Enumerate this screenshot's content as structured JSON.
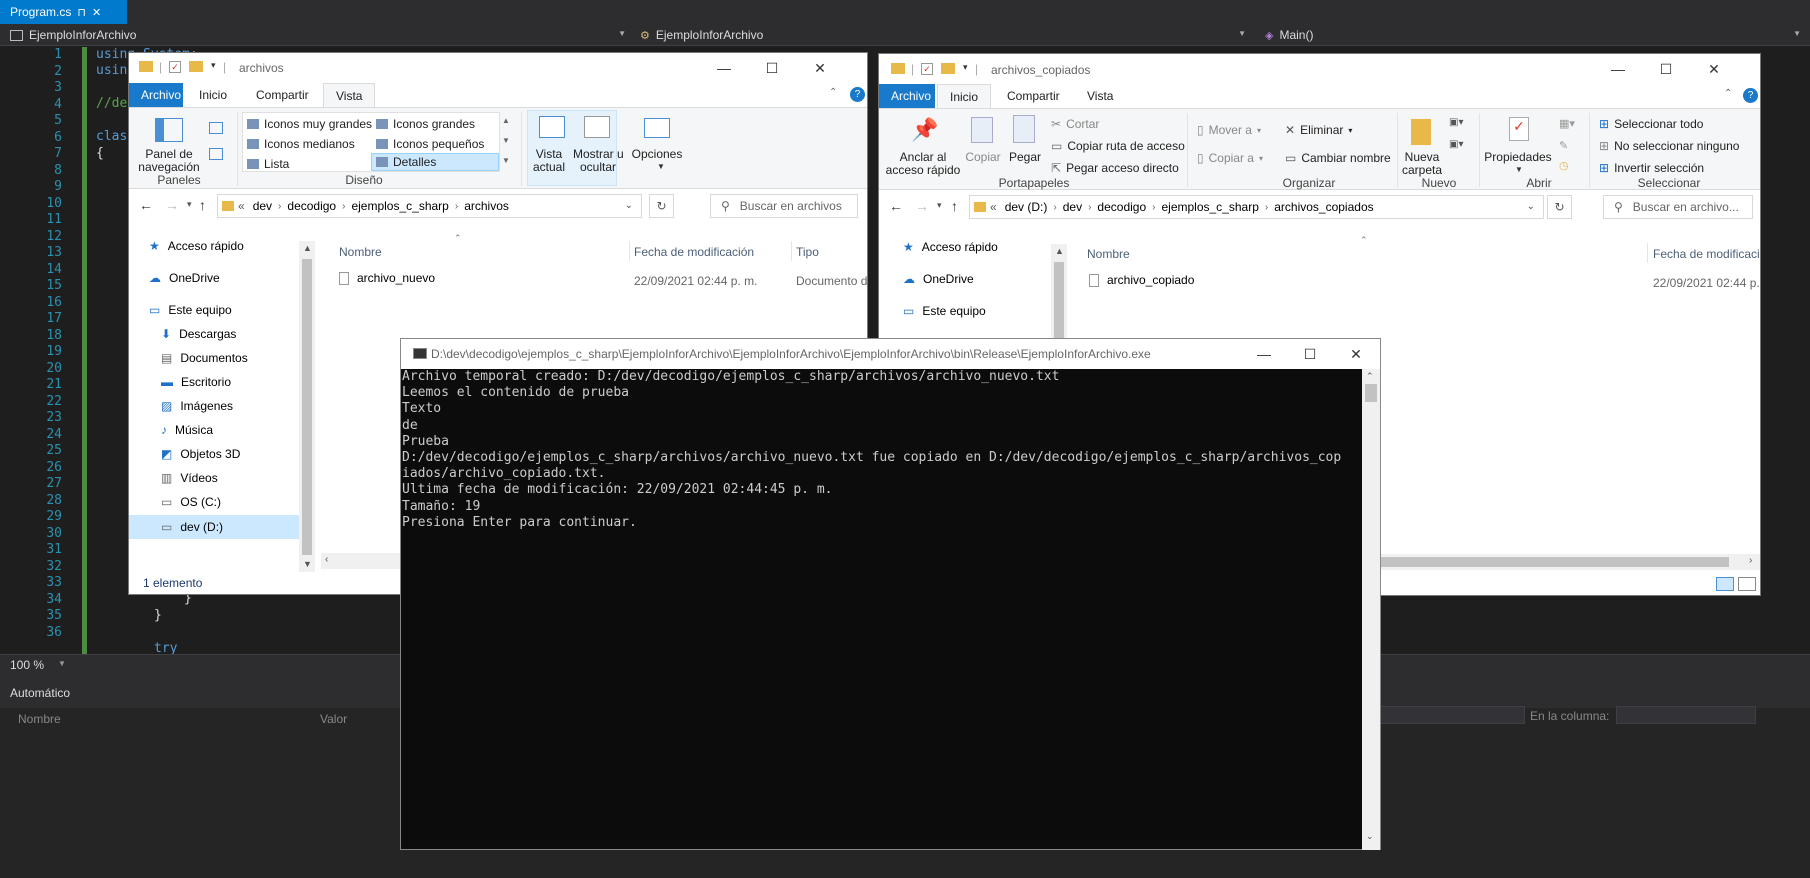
{
  "vs": {
    "tab_title": "Program.cs",
    "tab_pin": "⊓",
    "tab_close": "✕",
    "nav_project": "EjemploInforArchivo",
    "nav_class": "EjemploInforArchivo",
    "nav_member": "Main()",
    "line_numbers": [
      "1",
      "2",
      "3",
      "4",
      "5",
      "6",
      "7",
      "8",
      "9",
      "10",
      "11",
      "12",
      "13",
      "14",
      "15",
      "16",
      "17",
      "18",
      "19",
      "20",
      "21",
      "22",
      "23",
      "24",
      "25",
      "26",
      "27",
      "28",
      "29",
      "30",
      "31",
      "32",
      "33",
      "34",
      "35",
      "36"
    ],
    "code_visible": {
      "l1": "using System;",
      "l2": "using",
      "l4": "//de",
      "l6": "clas",
      "l7": "{",
      "l33": "}",
      "l34": "}",
      "l36": "try"
    },
    "zoom": "100 %",
    "auto_title": "Automático",
    "col_name": "Nombre",
    "col_value": "Valor",
    "col_label": "En la columna:"
  },
  "explorer_left": {
    "title": "archivos",
    "tabs": [
      "Archivo",
      "Inicio",
      "Compartir",
      "Vista"
    ],
    "ribbon": {
      "panel_nav": "Panel de\nnavegación",
      "paneles_label": "Paneles",
      "layouts": [
        "Iconos muy grandes",
        "Iconos grandes",
        "Iconos medianos",
        "Iconos pequeños",
        "Lista",
        "Detalles"
      ],
      "diseno_label": "Diseño",
      "vista_actual": "Vista\nactual",
      "mostrar": "Mostrar u\nocultar",
      "opciones": "Opciones"
    },
    "breadcrumb": [
      "dev",
      "decodigo",
      "ejemplos_c_sharp",
      "archivos"
    ],
    "search_placeholder": "Buscar en archivos",
    "nav": [
      "Acceso rápido",
      "OneDrive",
      "Este equipo",
      "Descargas",
      "Documentos",
      "Escritorio",
      "Imágenes",
      "Música",
      "Objetos 3D",
      "Vídeos",
      "OS (C:)",
      "dev (D:)"
    ],
    "columns": [
      "Nombre",
      "Fecha de modificación",
      "Tipo"
    ],
    "file": {
      "name": "archivo_nuevo",
      "date": "22/09/2021 02:44 p. m.",
      "type": "Documento d"
    },
    "status": "1 elemento"
  },
  "explorer_right": {
    "title": "archivos_copiados",
    "tabs": [
      "Archivo",
      "Inicio",
      "Compartir",
      "Vista"
    ],
    "ribbon": {
      "anclar": "Anclar al\nacceso rápido",
      "copiar": "Copiar",
      "pegar": "Pegar",
      "cortar": "Cortar",
      "copiar_ruta": "Copiar ruta de acceso",
      "pegar_acceso": "Pegar acceso directo",
      "portapapeles": "Portapapeles",
      "mover": "Mover a",
      "copiar_a": "Copiar a",
      "eliminar": "Eliminar",
      "cambiar": "Cambiar nombre",
      "organizar": "Organizar",
      "nueva_carpeta": "Nueva\ncarpeta",
      "nuevo": "Nuevo",
      "propiedades": "Propiedades",
      "abrir": "Abrir",
      "sel_todo": "Seleccionar todo",
      "no_sel": "No seleccionar ninguno",
      "invertir": "Invertir selección",
      "seleccionar": "Seleccionar"
    },
    "breadcrumb": [
      "dev (D:)",
      "dev",
      "decodigo",
      "ejemplos_c_sharp",
      "archivos_copiados"
    ],
    "search_placeholder": "Buscar en archivo...",
    "nav": [
      "Acceso rápido",
      "OneDrive",
      "Este equipo"
    ],
    "columns": [
      "Nombre",
      "Fecha de modificaci"
    ],
    "file": {
      "name": "archivo_copiado",
      "date": "22/09/2021 02:44 p."
    }
  },
  "console": {
    "title": "D:\\dev\\decodigo\\ejemplos_c_sharp\\EjemploInforArchivo\\EjemploInforArchivo\\EjemploInforArchivo\\bin\\Release\\EjemploInforArchivo.exe",
    "lines": [
      "Archivo temporal creado: D:/dev/decodigo/ejemplos_c_sharp/archivos/archivo_nuevo.txt",
      "Leemos el contenido de prueba",
      "Texto",
      "de",
      "Prueba",
      "D:/dev/decodigo/ejemplos_c_sharp/archivos/archivo_nuevo.txt fue copiado en D:/dev/decodigo/ejemplos_c_sharp/archivos_cop",
      "iados/archivo_copiado.txt.",
      "Ultima fecha de modificación: 22/09/2021 02:44:45 p. m.",
      "Tamaño: 19",
      "Presiona Enter para continuar."
    ]
  },
  "colors": {
    "vs_accent": "#007acc",
    "file_tab": "#1979ca",
    "selection": "#cce8ff"
  }
}
